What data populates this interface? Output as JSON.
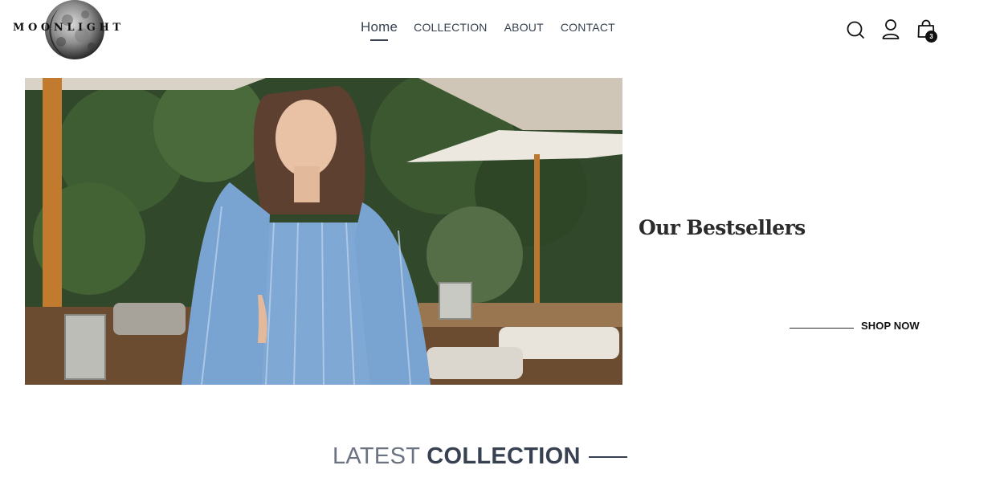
{
  "brand": {
    "name": "MOONLIGHT"
  },
  "nav": {
    "items": [
      {
        "label": "Home",
        "active": true
      },
      {
        "label": "COLLECTION"
      },
      {
        "label": "ABOUT"
      },
      {
        "label": "CONTACT"
      }
    ]
  },
  "header_icons": {
    "search": "search-icon",
    "profile": "profile-icon",
    "cart": "cart-icon",
    "cart_count": "3"
  },
  "hero": {
    "title": "Our Bestsellers",
    "cta_label": "SHOP NOW"
  },
  "latest": {
    "title_light": "LATEST",
    "title_bold": "COLLECTION"
  },
  "colors": {
    "text": "#374151",
    "muted": "#6b7280",
    "black": "#111111",
    "background": "#ffffff"
  }
}
